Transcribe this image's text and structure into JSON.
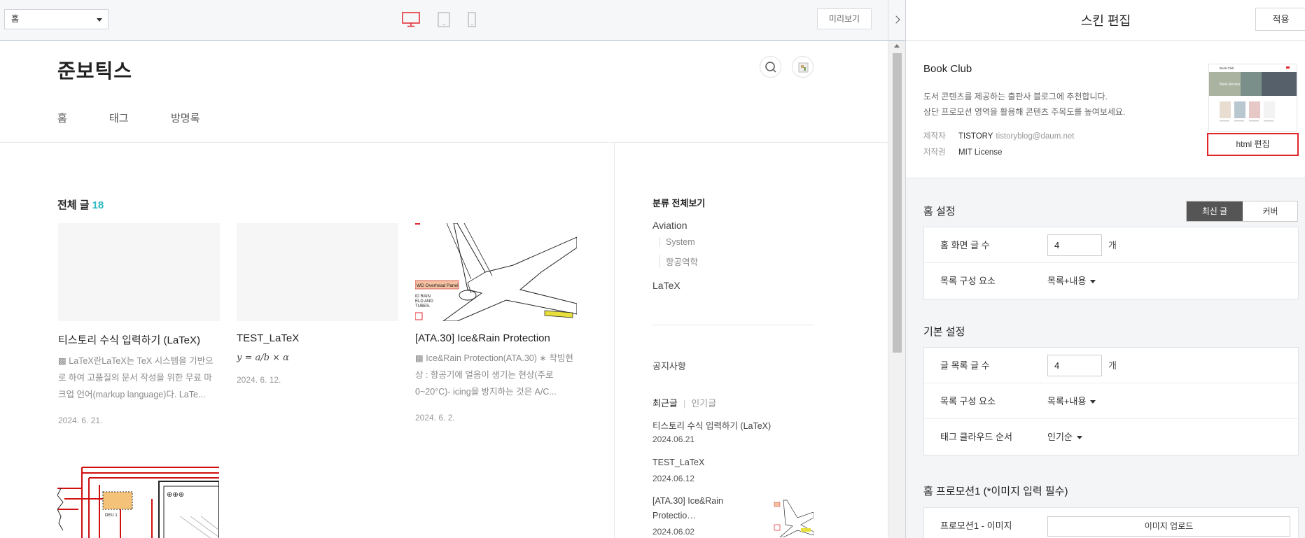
{
  "toolbar": {
    "page_select": "홈",
    "preview_label": "미리보기",
    "colors": {
      "active_device": "#e0262d",
      "inactive_device": "#b3b3b3"
    }
  },
  "blog": {
    "title": "준보틱스",
    "nav": [
      "홈",
      "태그",
      "방명록"
    ],
    "total_label": "전체 글",
    "total_count": "18",
    "posts": [
      {
        "title": "티스토리 수식 입력하기 (LaTeX)",
        "excerpt": "▩ LaTeX란LaTeX는 TeX 시스템을 기반으로 하여 고품질의 문서 작성을 위한 무료 마크업 언어(markup language)다. LaTe...",
        "date": "2024. 6. 21."
      },
      {
        "title": "TEST_LaTeX",
        "excerpt": "y = a/b × α",
        "date": "2024. 6. 12."
      },
      {
        "title": "[ATA.30] Ice&Rain Protection",
        "excerpt": "▩ Ice&Rain Protection(ATA.30) ∗ 착빙현상 : 항공기에 얼음이 생기는 현상(주로 0~20°C)- icing을 방지하는 것은 A/C...",
        "date": "2024. 6. 2.",
        "thumb_label": "WD Overhead Panel"
      }
    ],
    "post4_thumb_label": "DEU 1",
    "sidebar": {
      "category_head": "분류 전체보기",
      "categories": [
        {
          "name": "Aviation",
          "subs": [
            "System",
            "항공역학"
          ]
        },
        {
          "name": "LaTeX",
          "subs": []
        }
      ],
      "notice": "공지사항",
      "tab_recent": "최근글",
      "tab_popular": "인기글",
      "recent": [
        {
          "title": "티스토리 수식 입력하기 (LaTeX)",
          "date": "2024.06.21"
        },
        {
          "title": "TEST_LaTeX",
          "date": "2024.06.12"
        },
        {
          "title": "[ATA.30] Ice&Rain",
          "title2": "Protectio…",
          "date": "2024.06.02"
        }
      ]
    }
  },
  "editor": {
    "title": "스킨 편집",
    "apply": "적용",
    "skin": {
      "name": "Book Club",
      "desc1": "도서 콘텐츠를 제공하는 출판사 블로그에 추천합니다.",
      "desc2": "상단 프로모션 영역을 활용해 콘텐츠 주목도를 높여보세요.",
      "maker_key": "제작자",
      "maker": "TISTORY",
      "maker_email": "tistoryblog@daum.net",
      "license_key": "저작권",
      "license": "MIT License",
      "html_edit": "html 편집",
      "thumb_title": "Book Club",
      "thumb_banner": "Book Review"
    },
    "home": {
      "title": "홈 설정",
      "toggle_on": "최신 글",
      "toggle_off": "커버",
      "rows": [
        {
          "label": "홈 화면 글 수",
          "value": "4",
          "unit": "개"
        },
        {
          "label": "목록 구성 요소",
          "value": "목록+내용"
        }
      ]
    },
    "basic": {
      "title": "기본 설정",
      "rows": [
        {
          "label": "글 목록 글 수",
          "value": "4",
          "unit": "개"
        },
        {
          "label": "목록 구성 요소",
          "value": "목록+내용"
        },
        {
          "label": "태그 클라우드 순서",
          "value": "인기순"
        }
      ]
    },
    "promo": {
      "title": "홈 프로모션1 (*이미지 입력 필수)",
      "row_label": "프로모션1 - 이미지",
      "upload": "이미지 업로드"
    }
  }
}
